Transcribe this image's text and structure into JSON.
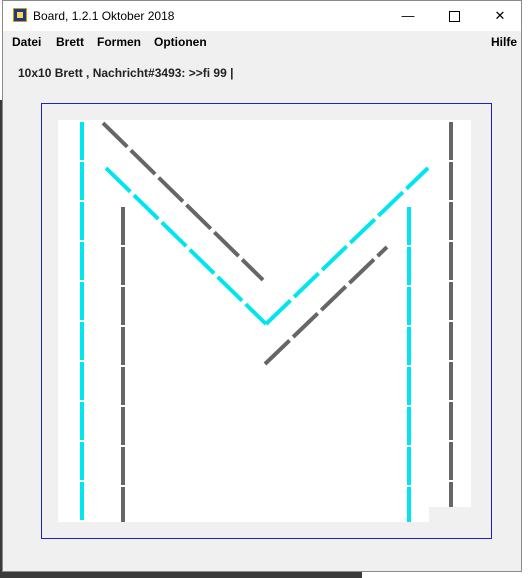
{
  "window": {
    "title": "Board, 1.2.1 Oktober 2018",
    "controls": {
      "minimize": "—",
      "close": "✕"
    }
  },
  "menu": {
    "datei": "Datei",
    "brett": "Brett",
    "formen": "Formen",
    "optionen": "Optionen",
    "hilfe": "Hilfe"
  },
  "status": {
    "text": "10x10 Brett , Nachricht#3493: >>fi 99 |"
  },
  "board": {
    "colors": {
      "cyan": "#00e5ee",
      "gray": "#666666",
      "frame": "#2020c0"
    }
  }
}
